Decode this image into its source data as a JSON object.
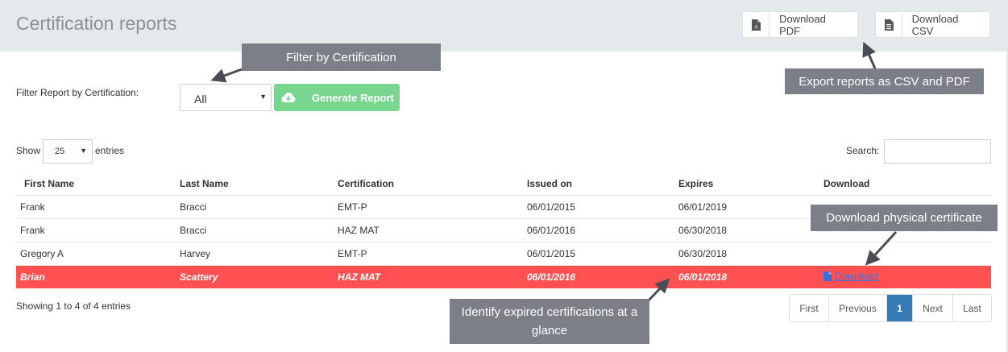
{
  "header": {
    "title": "Certification reports",
    "download_pdf": "Download PDF",
    "download_csv": "Download CSV"
  },
  "filter": {
    "label": "Filter Report by Certification:",
    "selected": "All",
    "generate_label": "Generate Report"
  },
  "table_controls": {
    "show_label": "Show",
    "page_size": "25",
    "entries_label": "entries",
    "search_label": "Search:",
    "search_value": ""
  },
  "table": {
    "columns": [
      "First Name",
      "Last Name",
      "Certification",
      "Issued on",
      "Expires",
      "Download"
    ],
    "rows": [
      {
        "first": "Frank",
        "last": "Bracci",
        "cert": "EMT-P",
        "issued": "06/01/2015",
        "expires": "06/01/2019",
        "download": ""
      },
      {
        "first": "Frank",
        "last": "Bracci",
        "cert": "HAZ MAT",
        "issued": "06/01/2016",
        "expires": "06/30/2018",
        "download": ""
      },
      {
        "first": "Gregory A",
        "last": "Harvey",
        "cert": "EMT-P",
        "issued": "06/01/2015",
        "expires": "06/30/2018",
        "download": ""
      },
      {
        "first": "Brian",
        "last": "Scattery",
        "cert": "HAZ MAT",
        "issued": "06/01/2016",
        "expires": "06/01/2018",
        "download": "Download"
      }
    ],
    "expired_color": "#ff5151"
  },
  "footer": {
    "showing": "Showing 1 to 4 of 4 entries",
    "pagination": {
      "first": "First",
      "previous": "Previous",
      "current": "1",
      "next": "Next",
      "last": "Last"
    }
  },
  "callouts": {
    "filter": "Filter by Certification",
    "export": "Export reports as CSV and PDF",
    "download": "Download physical certificate",
    "expired": "Identify expired certifications at a glance"
  },
  "colors": {
    "header_bg": "#e4e9ec",
    "generate_button": "#78d68f",
    "callout_bg": "#7c7f87",
    "pagination_active": "#337ab7"
  }
}
